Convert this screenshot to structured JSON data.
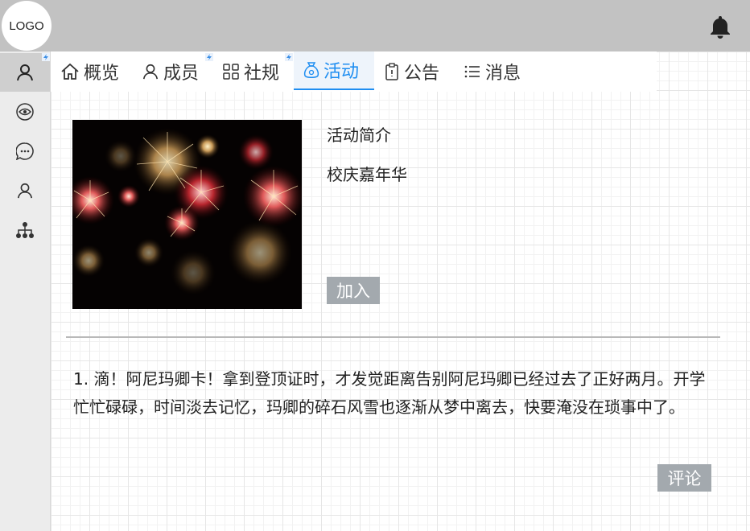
{
  "header": {
    "logo_text": "LOGO",
    "notification_icon": "bell-icon"
  },
  "sidebar": {
    "items": [
      {
        "icon": "user-icon",
        "active": true,
        "badge": true
      },
      {
        "icon": "eye-icon"
      },
      {
        "icon": "chat-icon"
      },
      {
        "icon": "user-icon"
      },
      {
        "icon": "org-chart-icon"
      }
    ]
  },
  "tabs": [
    {
      "label": "概览",
      "icon": "home-icon"
    },
    {
      "label": "成员",
      "icon": "user-icon",
      "badge": true
    },
    {
      "label": "社规",
      "icon": "grid-icon",
      "badge": true
    },
    {
      "label": "活动",
      "icon": "money-bag-icon",
      "active": true
    },
    {
      "label": "公告",
      "icon": "clipboard-icon"
    },
    {
      "label": "消息",
      "icon": "list-icon"
    }
  ],
  "activity": {
    "image_icon": "fireworks-image",
    "intro_label": "活动简介",
    "name": "校庆嘉年华",
    "join_label": "加入"
  },
  "comments": [
    {
      "text": "1. 滴！阿尼玛卿卡！拿到登顶证时，才发觉距离告别阿尼玛卿已经过去了正好两月。开学忙忙碌碌，时间淡去记忆，玛卿的碎石风雪也逐渐从梦中离去，快要淹没在琐事中了。"
    }
  ],
  "comment_button_label": "评论",
  "colors": {
    "topbar": "#c2c2c2",
    "accent": "#1f8ef1",
    "button": "#a3a9ae"
  }
}
